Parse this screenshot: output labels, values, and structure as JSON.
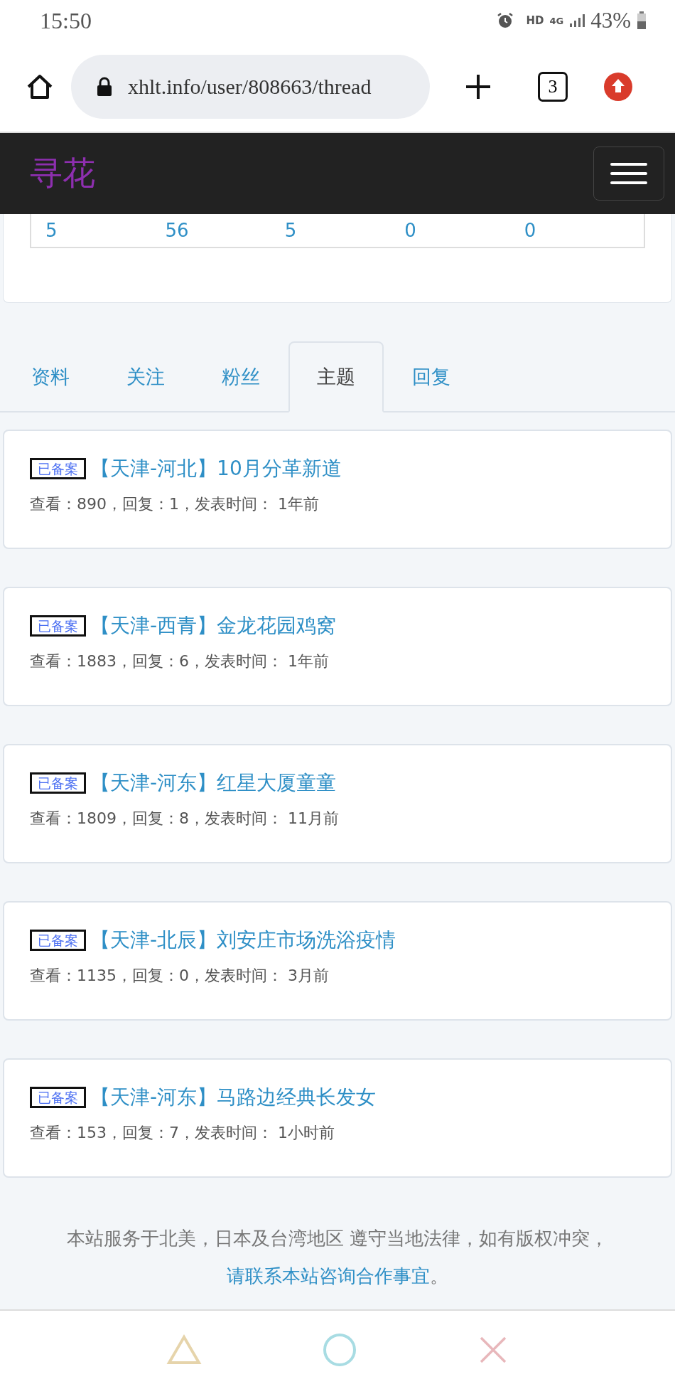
{
  "status_bar": {
    "time": "15:50",
    "network_label": "HD",
    "network_type": "4G",
    "battery": "43%"
  },
  "browser": {
    "url": "xhlt.info/user/808663/thread",
    "tab_count": "3"
  },
  "navbar": {
    "brand": "寻花"
  },
  "stats": [
    "5",
    "56",
    "5",
    "0",
    "0"
  ],
  "tabs": [
    {
      "label": "资料",
      "selected": false
    },
    {
      "label": "关注",
      "selected": false
    },
    {
      "label": "粉丝",
      "selected": false
    },
    {
      "label": "主题",
      "selected": true
    },
    {
      "label": "回复",
      "selected": false
    }
  ],
  "threads": [
    {
      "badge": "已备案",
      "title": "【天津-河北】10月分革新道",
      "meta": "查看：890，回复：1，发表时间： 1年前"
    },
    {
      "badge": "已备案",
      "title": "【天津-西青】金龙花园鸡窝",
      "meta": "查看：1883，回复：6，发表时间： 1年前"
    },
    {
      "badge": "已备案",
      "title": "【天津-河东】红星大厦童童",
      "meta": "查看：1809，回复：8，发表时间： 11月前"
    },
    {
      "badge": "已备案",
      "title": "【天津-北辰】刘安庄市场洗浴疫情",
      "meta": "查看：1135，回复：0，发表时间： 3月前"
    },
    {
      "badge": "已备案",
      "title": "【天津-河东】马路边经典长发女",
      "meta": "查看：153，回复：7，发表时间： 1小时前"
    }
  ],
  "footer": {
    "text": "本站服务于北美，日本及台湾地区 遵守当地法律，如有版权冲突，",
    "link": "请联系本站咨询合作事宜",
    "end": "。"
  }
}
